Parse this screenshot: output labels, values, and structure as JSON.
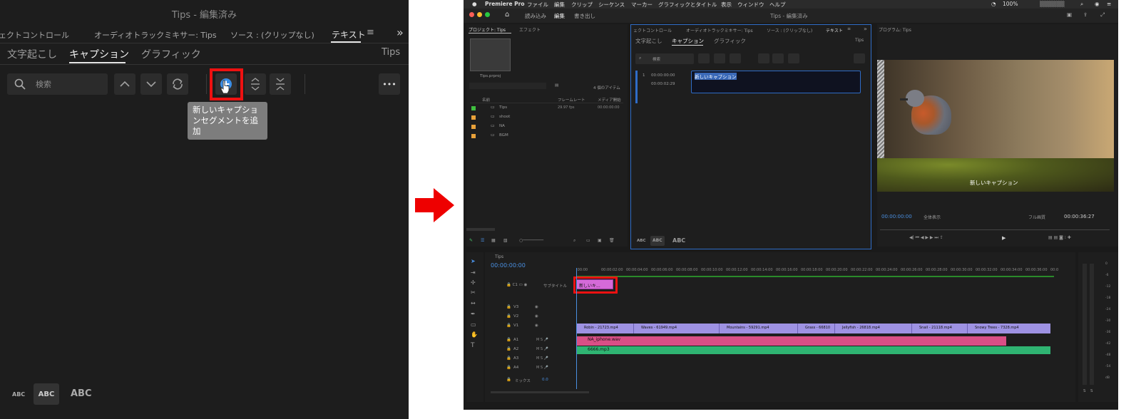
{
  "zoom": {
    "window_title": "Tips - 編集済み",
    "panel_tabs": [
      "ェクトコントロール",
      "オーディオトラックミキサー: Tips",
      "ソース : (クリップなし)",
      "テキスト"
    ],
    "menu_glyph": "≡",
    "expand_glyph": "»",
    "sub_tabs": [
      "文字起こし",
      "キャプション",
      "グラフィック"
    ],
    "sequence_name": "Tips",
    "search_placeholder": "検索",
    "tooltip": "新しいキャプションセグメントを追加",
    "more_glyph": "•••",
    "text_sizes": [
      "ABC",
      "ABC",
      "ABC"
    ]
  },
  "app": {
    "name": "Premiere Pro",
    "menus": [
      "ファイル",
      "編集",
      "クリップ",
      "シーケンス",
      "マーカー",
      "グラフィックとタイトル",
      "表示",
      "ウィンドウ",
      "ヘルプ"
    ],
    "battery": "100%",
    "workspaces": [
      "読み込み",
      "編集",
      "書き出し"
    ],
    "window_title": "Tips - 編集済み"
  },
  "project": {
    "tabs": [
      "プロジェクト: Tips",
      "エフェクト"
    ],
    "file_name": "Tips.prproj",
    "item_count": "4 個のアイテム",
    "columns": [
      "名前",
      "フレームレート",
      "メディア開始"
    ],
    "items": [
      {
        "name": "Tips",
        "fps": "29.97 fps",
        "start": "00:00:00:00",
        "color": "#3fbf3f"
      },
      {
        "name": "shoot",
        "fps": "",
        "start": "",
        "color": "#e8a13a"
      },
      {
        "name": "NA",
        "fps": "",
        "start": "",
        "color": "#e8a13a"
      },
      {
        "name": "BGM",
        "fps": "",
        "start": "",
        "color": "#e8a13a"
      }
    ]
  },
  "caption_panel": {
    "tabs": [
      "ェクトコントロール",
      "オーディオトラックミキサー: Tips",
      "ソース : (クリップなし)",
      "テキスト"
    ],
    "sub_tabs": [
      "文字起こし",
      "キャプション",
      "グラフィック"
    ],
    "sequence_name": "Tips",
    "search_placeholder": "検索",
    "segment": {
      "index": "1",
      "in": "00:00:00:00",
      "out": "00:00:02:29",
      "text": "新しいキャプション"
    },
    "text_sizes": [
      "ABC",
      "ABC",
      "ABC"
    ]
  },
  "program": {
    "title": "プログラム: Tips",
    "overlay_caption": "新しいキャプション",
    "current_time": "00:00:00:00",
    "zoom_select": "全体表示",
    "quality_select": "フル画質",
    "duration": "00:00:36:27"
  },
  "timeline": {
    "sequence_tab": "Tips",
    "timecode": "00:00:00:00",
    "ruler": [
      ":00:00",
      "00:00:02:00",
      "00:00:04:00",
      "00:00:06:00",
      "00:00:08:00",
      "00:00:10:00",
      "00:00:12:00",
      "00:00:14:00",
      "00:00:16:00",
      "00:00:18:00",
      "00:00:20:00",
      "00:00:22:00",
      "00:00:24:00",
      "00:00:26:00",
      "00:00:28:00",
      "00:00:30:00",
      "00:00:32:00",
      "00:00:34:00",
      "00:00:36:00",
      "00:0"
    ],
    "subtitle_track": "サブタイトル",
    "caption_clip": "新しいキ...",
    "video_tracks": [
      "V3",
      "V2",
      "V1"
    ],
    "audio_tracks": [
      "A1",
      "A2",
      "A3",
      "A4"
    ],
    "mix_label": "ミックス",
    "mix_value": "0.0",
    "video_clips": [
      "Robin - 21723.mp4",
      "Waves - 61949.mp4",
      "Mountains - 59291.mp4",
      "Grass - 66810",
      "Jellyfish - 26818.mp4",
      "Snail - 21118.mp4",
      "Snowy Trees - 7328.mp4"
    ],
    "audio_clips": [
      "NA_iphone.wav",
      "6666.mp3"
    ]
  },
  "meter": {
    "scale": [
      "0",
      "-6",
      "-12",
      "-18",
      "-24",
      "-30",
      "-36",
      "-42",
      "-48",
      "-54",
      "dB"
    ],
    "bottom": [
      "S",
      "S"
    ]
  }
}
